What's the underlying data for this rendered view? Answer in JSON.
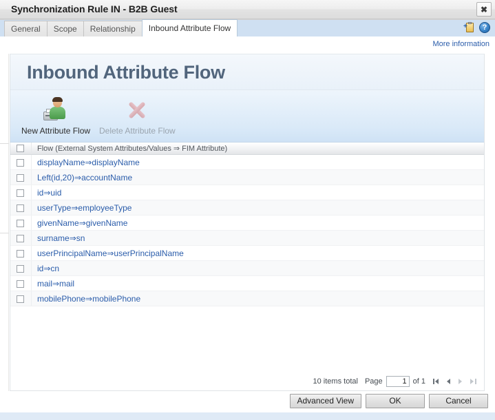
{
  "window": {
    "title": "Synchronization Rule IN - B2B Guest",
    "close_label": "✖"
  },
  "tabs": [
    {
      "label": "General",
      "active": false
    },
    {
      "label": "Scope",
      "active": false
    },
    {
      "label": "Relationship",
      "active": false
    },
    {
      "label": "Inbound Attribute Flow",
      "active": true
    }
  ],
  "tab_icons": {
    "new_clipboard": "add-clipboard-icon",
    "help": "?",
    "help_icon": "help-icon"
  },
  "more_information": "More information",
  "panel": {
    "title": "Inbound Attribute Flow"
  },
  "toolbar": {
    "new_label": "New Attribute Flow",
    "new_icon": "new-attribute-flow-icon",
    "delete_label": "Delete Attribute Flow",
    "delete_icon": "delete-attribute-flow-icon",
    "delete_disabled": true
  },
  "grid": {
    "header": "Flow (External System Attributes/Values ⇒ FIM Attribute)",
    "rows": [
      {
        "flow": "displayName⇒displayName",
        "checked": false
      },
      {
        "flow": "Left(id,20)⇒accountName",
        "checked": false
      },
      {
        "flow": "id⇒uid",
        "checked": false
      },
      {
        "flow": "userType⇒employeeType",
        "checked": false
      },
      {
        "flow": "givenName⇒givenName",
        "checked": false
      },
      {
        "flow": "surname⇒sn",
        "checked": false
      },
      {
        "flow": "userPrincipalName⇒userPrincipalName",
        "checked": false
      },
      {
        "flow": "id⇒cn",
        "checked": false
      },
      {
        "flow": "mail⇒mail",
        "checked": false
      },
      {
        "flow": "mobilePhone⇒mobilePhone",
        "checked": false
      }
    ]
  },
  "pager": {
    "items_total": "10 items total",
    "page_label": "Page",
    "page_value": "1",
    "of_label": "of 1",
    "first_icon": "first-page-icon",
    "prev_icon": "previous-page-icon",
    "next_icon": "next-page-icon",
    "last_icon": "last-page-icon"
  },
  "footer": {
    "advanced_view": "Advanced View",
    "ok": "OK",
    "cancel": "Cancel"
  },
  "colors": {
    "link": "#2a5caa",
    "panel_title": "#51657c",
    "tabstrip": "#cfe0f2",
    "toolbar_top": "#eef5fc",
    "toolbar_bottom": "#cfe2f5",
    "footer_strip": "#dfeaf6"
  }
}
